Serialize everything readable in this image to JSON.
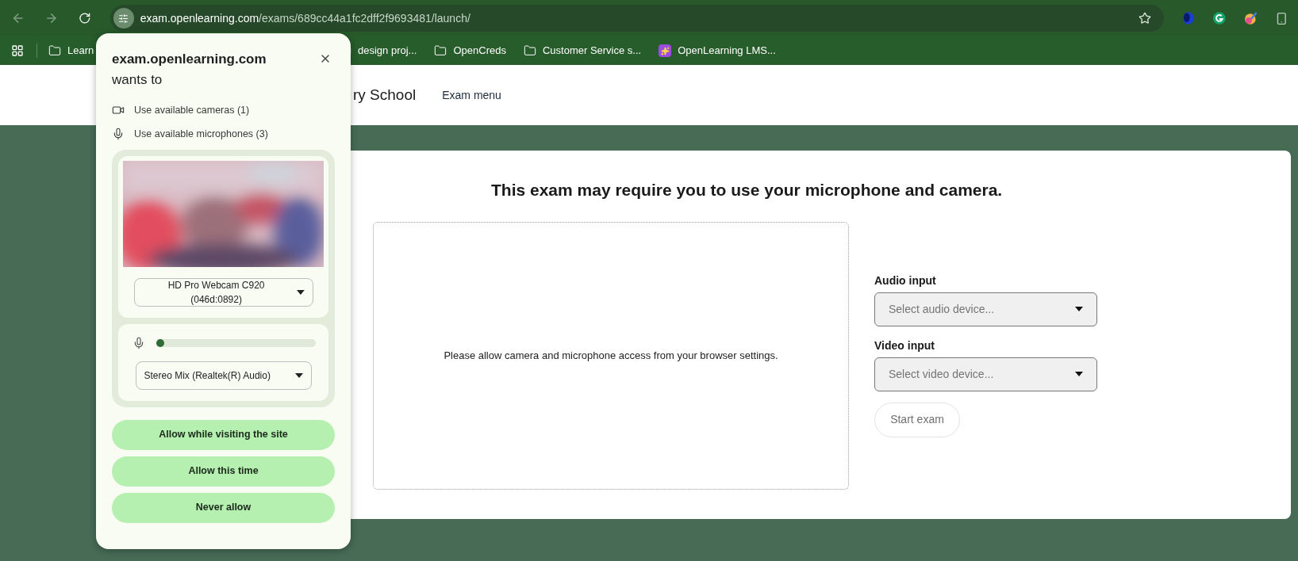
{
  "browser": {
    "address": {
      "domain": "exam.openlearning.com",
      "path": "/exams/689cc44a1fc2dff2f9693481/launch/"
    },
    "bookmarks": [
      {
        "kind": "folder",
        "label": "Learn"
      },
      {
        "kind": "folder",
        "label": "design proj..."
      },
      {
        "kind": "folder",
        "label": "OpenCreds"
      },
      {
        "kind": "folder",
        "label": "Customer Service s..."
      },
      {
        "kind": "app",
        "label": "OpenLearning LMS..."
      }
    ]
  },
  "header": {
    "school": "ry School",
    "menu": "Exam menu"
  },
  "card": {
    "title": "This exam may require you to use your microphone and camera.",
    "message": "Please allow camera and microphone access from your browser settings.",
    "fields": [
      {
        "label": "Audio input",
        "placeholder": "Select audio device..."
      },
      {
        "label": "Video input",
        "placeholder": "Select video device..."
      }
    ],
    "start_button": {
      "label": "Start exam",
      "disabled": true
    }
  },
  "popup": {
    "title": "**exam.openlearning.com** wants to",
    "permissions": [
      {
        "kind": "camera",
        "label": "Use available cameras (1)"
      },
      {
        "kind": "microphone",
        "label": "Use available microphones (3)"
      }
    ],
    "camera_select": "HD Pro Webcam C920 (046d:0892)",
    "mic": {
      "level": 0.03
    },
    "mic_select": "Stereo Mix (Realtek(R) Audio)",
    "buttons": [
      "Allow while visiting the site",
      "Allow this time",
      "Never allow"
    ]
  }
}
